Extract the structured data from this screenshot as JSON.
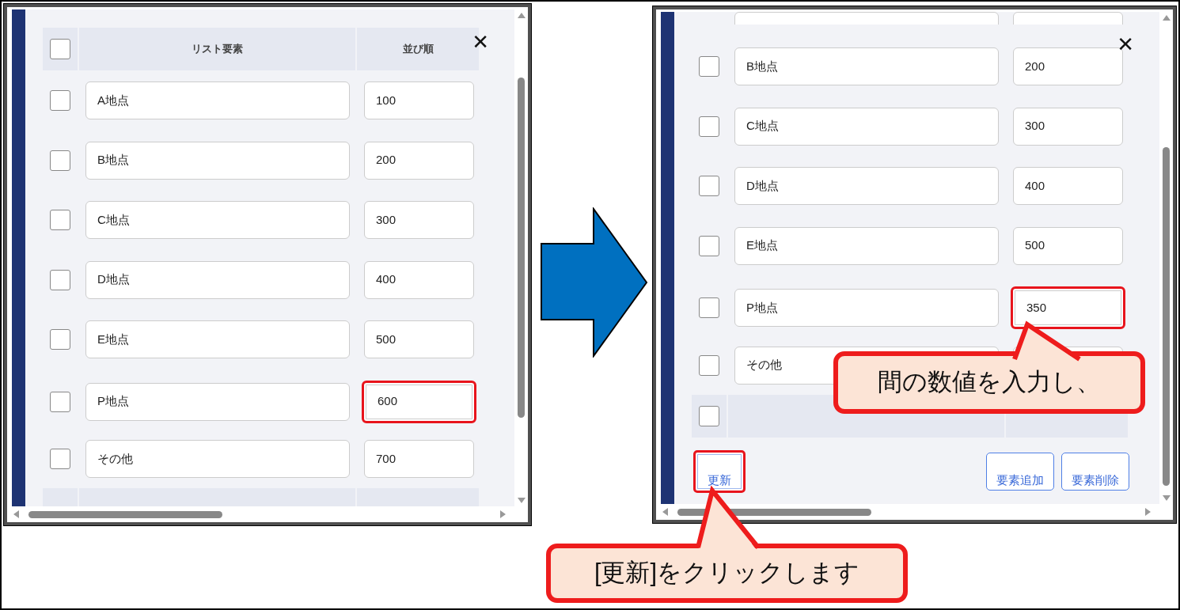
{
  "screens": [
    {
      "close_button": "✕",
      "items": [
        {
          "kind": "header",
          "checked": false,
          "columns": [
            "リスト要素",
            "並び順"
          ]
        },
        {
          "kind": "row",
          "checked": false,
          "name": "A地点",
          "order": "100",
          "highlighted": false
        },
        {
          "kind": "row",
          "checked": false,
          "name": "B地点",
          "order": "200",
          "highlighted": false
        },
        {
          "kind": "row",
          "checked": false,
          "name": "C地点",
          "order": "300",
          "highlighted": false
        },
        {
          "kind": "row",
          "checked": false,
          "name": "D地点",
          "order": "400",
          "highlighted": false
        },
        {
          "kind": "row",
          "checked": false,
          "name": "E地点",
          "order": "500",
          "highlighted": false
        },
        {
          "kind": "row",
          "checked": false,
          "name": "P地点",
          "order": "600",
          "highlighted": true
        },
        {
          "kind": "row",
          "checked": false,
          "name": "その他",
          "order": "700",
          "highlighted": false
        },
        {
          "kind": "header"
        }
      ]
    },
    {
      "close_button": "✕",
      "items": [
        {
          "kind": "partial_row"
        },
        {
          "kind": "row",
          "checked": false,
          "name": "B地点",
          "order": "200",
          "highlighted": false
        },
        {
          "kind": "row",
          "checked": false,
          "name": "C地点",
          "order": "300",
          "highlighted": false
        },
        {
          "kind": "row",
          "checked": false,
          "name": "D地点",
          "order": "400",
          "highlighted": false
        },
        {
          "kind": "row",
          "checked": false,
          "name": "E地点",
          "order": "500",
          "highlighted": false
        },
        {
          "kind": "row",
          "checked": false,
          "name": "P地点",
          "order": "350",
          "highlighted": true
        },
        {
          "kind": "row",
          "checked": false,
          "name": "その他",
          "highlighted": false
        },
        {
          "kind": "header",
          "checked": false
        },
        {
          "kind": "buttons",
          "buttons": [
            {
              "label": "更新",
              "highlighted": true
            },
            {
              "label": "要素追加",
              "highlighted": false
            },
            {
              "label": "要素削除",
              "highlighted": false
            }
          ]
        }
      ]
    }
  ],
  "callouts": [
    {
      "text": "間の数値を入力し、"
    },
    {
      "text": "[更新]をクリックします"
    }
  ]
}
